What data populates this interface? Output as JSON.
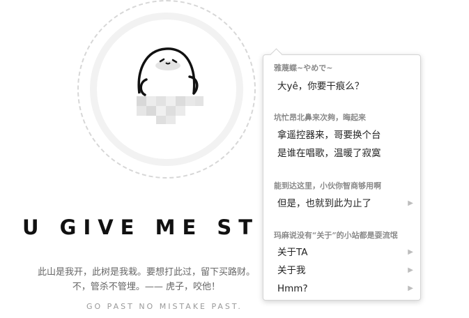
{
  "headline": "U GIVE ME ST",
  "motto": {
    "line1": "此山是我开，此树是我栽。要想打此过，留下买路财。",
    "line2": "不，管杀不管埋。—— 虎子，咬他！"
  },
  "tagline": "GO PAST NO MISTAKE PAST.",
  "menu": {
    "groups": [
      {
        "title": "雅蔑蝶~やめで~",
        "items": [
          {
            "label": "大yê，你要干痕么？"
          }
        ]
      },
      {
        "title": "坑忙昂北鼻来次夠，晦起来",
        "items": [
          {
            "label": "拿遥控器来，哥要换个台"
          },
          {
            "label": "是谁在唱歌，温暖了寂寞"
          }
        ]
      },
      {
        "title": "能到达这里，小伙你智商够用啊",
        "items": [
          {
            "label": "但是，也就到此为止了",
            "submenu": true
          }
        ]
      },
      {
        "title": "玛麻说没有“关于”的小站都是耍流氓",
        "items": [
          {
            "label": "关于TA",
            "submenu": true
          },
          {
            "label": "关于我",
            "submenu": true
          },
          {
            "label": "Hmm?",
            "submenu": true
          }
        ]
      }
    ],
    "chevron": "▶"
  }
}
